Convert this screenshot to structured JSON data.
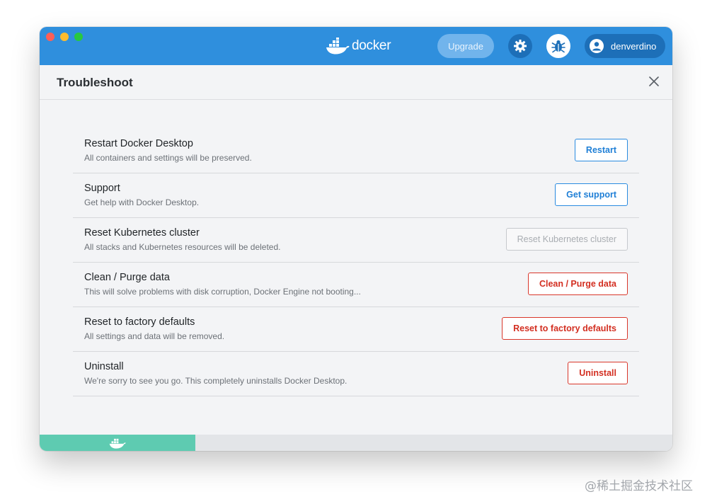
{
  "app": {
    "brand": "docker",
    "upgrade_label": "Upgrade",
    "username": "denverdino"
  },
  "header": {
    "title": "Troubleshoot"
  },
  "items": [
    {
      "title": "Restart Docker Desktop",
      "description": "All containers and settings will be preserved.",
      "button": "Restart",
      "style": "primary"
    },
    {
      "title": "Support",
      "description": "Get help with Docker Desktop.",
      "button": "Get support",
      "style": "primary"
    },
    {
      "title": "Reset Kubernetes cluster",
      "description": "All stacks and Kubernetes resources will be deleted.",
      "button": "Reset Kubernetes cluster",
      "style": "disabled"
    },
    {
      "title": "Clean / Purge data",
      "description": "This will solve problems with disk corruption, Docker Engine not booting...",
      "button": "Clean / Purge data",
      "style": "danger"
    },
    {
      "title": "Reset to factory defaults",
      "description": "All settings and data will be removed.",
      "button": "Reset to factory defaults",
      "style": "danger"
    },
    {
      "title": "Uninstall",
      "description": "We're sorry to see you go. This completely uninstalls Docker Desktop.",
      "button": "Uninstall",
      "style": "danger"
    }
  ],
  "watermark": "@稀土掘金技术社区",
  "colors": {
    "titlebar": "#2f8fdd",
    "primary": "#1f7fd6",
    "danger": "#d32f21",
    "status_running": "#5ecbb1"
  },
  "icons": [
    "docker-whale-icon",
    "gear-icon",
    "bug-icon",
    "user-avatar-icon",
    "close-icon"
  ]
}
